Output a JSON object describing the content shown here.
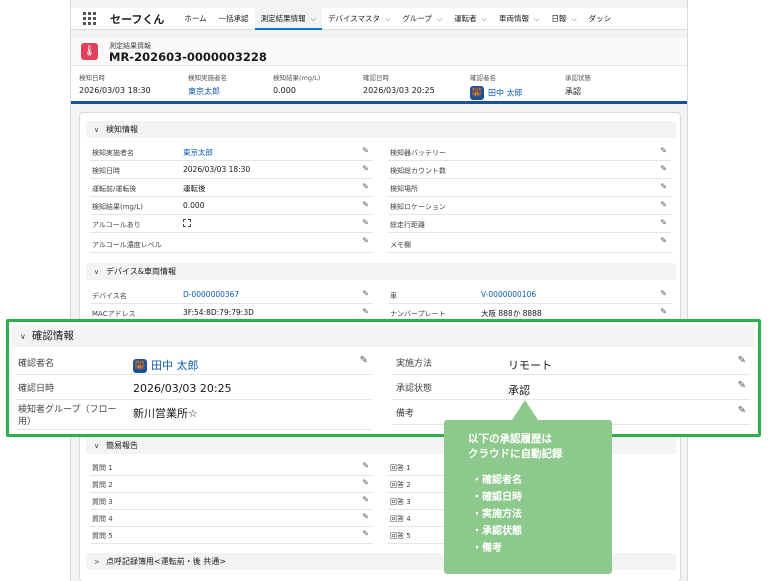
{
  "nav": {
    "app_name": "セーフくん",
    "items": [
      {
        "label": "ホーム",
        "chevron": false,
        "active": false
      },
      {
        "label": "一括承認",
        "chevron": false,
        "active": false
      },
      {
        "label": "測定結果情報",
        "chevron": true,
        "active": true
      },
      {
        "label": "デバイスマスタ",
        "chevron": true,
        "active": false
      },
      {
        "label": "グループ",
        "chevron": true,
        "active": false
      },
      {
        "label": "運転者",
        "chevron": true,
        "active": false
      },
      {
        "label": "車両情報",
        "chevron": true,
        "active": false
      },
      {
        "label": "日報",
        "chevron": true,
        "active": false
      },
      {
        "label": "ダッシ",
        "chevron": false,
        "active": false
      }
    ]
  },
  "record": {
    "object_label": "測定結果情報",
    "name": "MR-202603-0000003228",
    "header_fields": [
      {
        "label": "検知日時",
        "value": "2026/03/03 18:30",
        "link": false
      },
      {
        "label": "検知実施者名",
        "value": "東京太郎",
        "link": true
      },
      {
        "label": "検知結果(mg/L)",
        "value": "0.000",
        "link": false
      },
      {
        "label": "確認日時",
        "value": "2026/03/03 20:25",
        "link": false
      },
      {
        "label": "確認者名",
        "value": "田中 太郎",
        "link": true
      },
      {
        "label": "承認状態",
        "value": "承認",
        "link": false
      }
    ]
  },
  "sections": {
    "detection": {
      "title": "検知情報",
      "left": [
        {
          "label": "検知実施者名",
          "value": "東京太郎",
          "link": true
        },
        {
          "label": "検知日時",
          "value": "2026/03/03 18:30",
          "link": false
        },
        {
          "label": "運転前/運転後",
          "value": "運転後",
          "link": false
        },
        {
          "label": "検知結果(mg/L)",
          "value": "0.000",
          "link": false
        },
        {
          "label": "アルコールあり",
          "value": "",
          "checkbox": true
        },
        {
          "label": "アルコール濃度レベル",
          "value": "",
          "link": false
        }
      ],
      "right": [
        {
          "label": "検知器バッテリー",
          "value": ""
        },
        {
          "label": "検知総カウント数",
          "value": ""
        },
        {
          "label": "検知場所",
          "value": ""
        },
        {
          "label": "検知ロケーション",
          "value": ""
        },
        {
          "label": "総走行距離",
          "value": ""
        },
        {
          "label": "メモ欄",
          "value": ""
        }
      ]
    },
    "device": {
      "title": "デバイス&車両情報",
      "left": [
        {
          "label": "デバイス名",
          "value": "D-0000000367",
          "link": true
        },
        {
          "label": "MACアドレス",
          "value": "3F:54:8D:79:79:3D",
          "link": false
        }
      ],
      "right": [
        {
          "label": "車",
          "value": "V-0000000106",
          "link": true
        },
        {
          "label": "ナンバープレート",
          "value": "大阪 888か 8888",
          "link": false
        }
      ]
    },
    "confirm": {
      "title": "確認情報",
      "left": [
        {
          "label": "確認者名",
          "value": "田中 太郎",
          "link": true
        },
        {
          "label": "確認日時",
          "value": "2026/03/03 20:25",
          "link": false
        },
        {
          "label": "検知者グループ（フロー用）",
          "value": "新川営業所☆",
          "link": false
        }
      ],
      "right": [
        {
          "label": "実施方法",
          "value": "リモート"
        },
        {
          "label": "承認状態",
          "value": "承認"
        },
        {
          "label": "備考",
          "value": ""
        }
      ]
    },
    "report": {
      "title": "簡易報告",
      "left": [
        "質問 1",
        "質問 2",
        "質問 3",
        "質問 4",
        "質問 5"
      ],
      "right": [
        "回答 1",
        "回答 2",
        "回答 3",
        "回答 4",
        "回答 5"
      ]
    },
    "roll_call": {
      "title": "点呼記録簿用<運転前・後 共通>"
    }
  },
  "callout": {
    "title_line1": "以下の承認履歴は",
    "title_line2": "クラウドに自動記録",
    "items": [
      "・確認者名",
      "・確認日時",
      "・実施方法",
      "・承認状態",
      "・備考"
    ],
    "color": "#8dc98c"
  },
  "colors": {
    "accent": "#0176d3",
    "link": "#0b5cab",
    "highlight_border": "#2db04b",
    "record_icon": "#e3415a",
    "header_bar": "#1b5297"
  }
}
